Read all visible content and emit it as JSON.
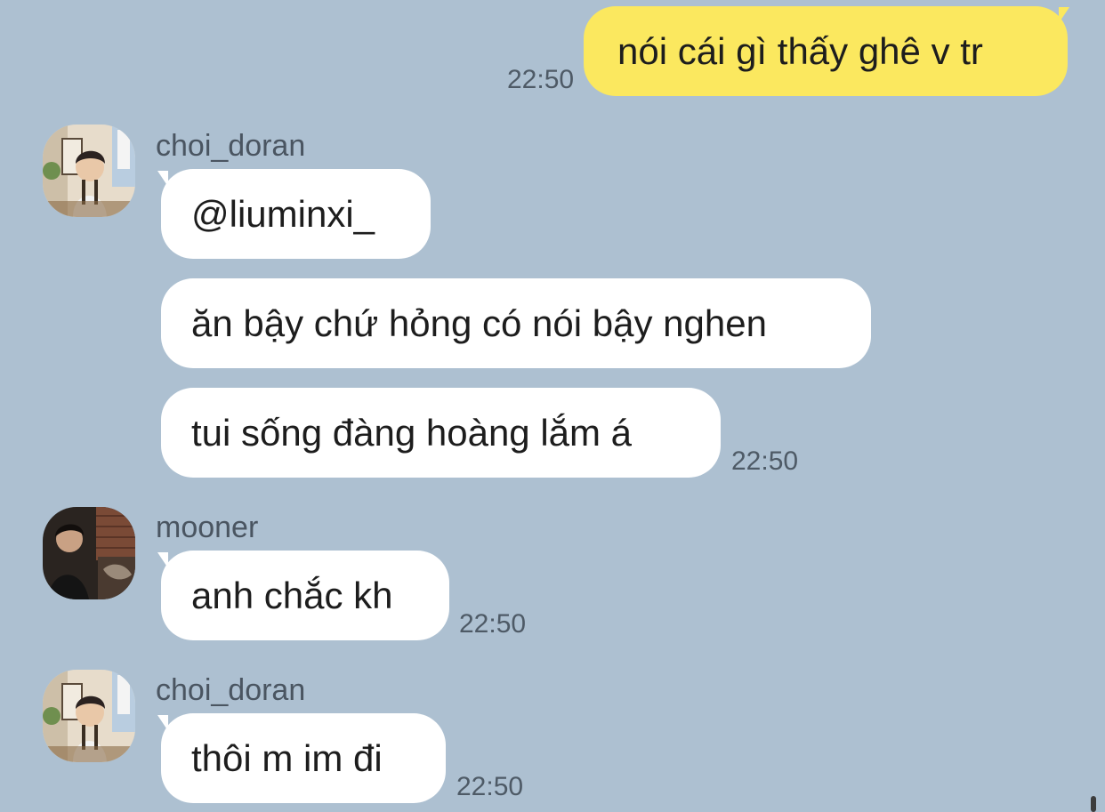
{
  "chat": {
    "messages": [
      {
        "direction": "outgoing",
        "text": "nói cái gì thấy ghê v tr",
        "time": "22:50"
      },
      {
        "direction": "incoming",
        "sender": "choi_doran",
        "avatar": "avatar-photo-icon",
        "texts": [
          "@liuminxi_",
          "ăn bậy chứ hỏng có nói bậy nghen",
          "tui sống đàng hoàng lắm á"
        ],
        "time": "22:50"
      },
      {
        "direction": "incoming",
        "sender": "mooner",
        "avatar": "avatar-photo-icon",
        "texts": [
          "anh chắc kh"
        ],
        "time": "22:50"
      },
      {
        "direction": "incoming",
        "sender": "choi_doran",
        "avatar": "avatar-photo-icon",
        "texts": [
          "thôi m im đi"
        ],
        "time": "22:50"
      }
    ]
  },
  "colors": {
    "background": "#adc0d1",
    "outgoing_bubble": "#fbe85f",
    "incoming_bubble": "#ffffff"
  }
}
